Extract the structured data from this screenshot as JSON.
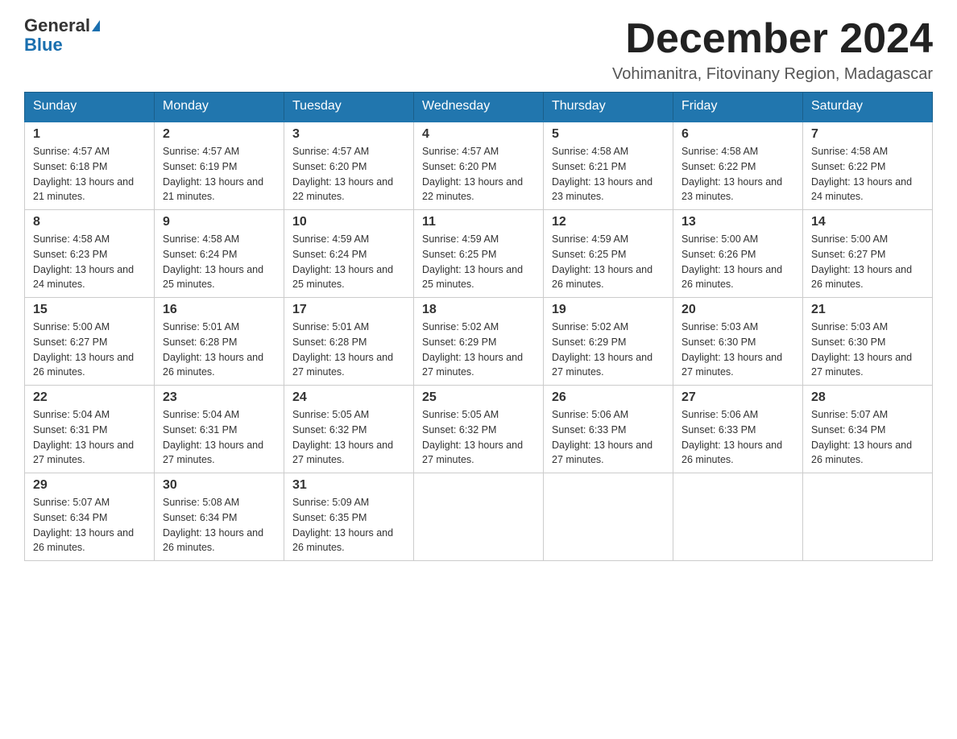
{
  "header": {
    "logo_general": "General",
    "logo_blue": "Blue",
    "month_title": "December 2024",
    "location": "Vohimanitra, Fitovinany Region, Madagascar"
  },
  "weekdays": [
    "Sunday",
    "Monday",
    "Tuesday",
    "Wednesday",
    "Thursday",
    "Friday",
    "Saturday"
  ],
  "weeks": [
    [
      {
        "day": "1",
        "sunrise": "4:57 AM",
        "sunset": "6:18 PM",
        "daylight": "13 hours and 21 minutes."
      },
      {
        "day": "2",
        "sunrise": "4:57 AM",
        "sunset": "6:19 PM",
        "daylight": "13 hours and 21 minutes."
      },
      {
        "day": "3",
        "sunrise": "4:57 AM",
        "sunset": "6:20 PM",
        "daylight": "13 hours and 22 minutes."
      },
      {
        "day": "4",
        "sunrise": "4:57 AM",
        "sunset": "6:20 PM",
        "daylight": "13 hours and 22 minutes."
      },
      {
        "day": "5",
        "sunrise": "4:58 AM",
        "sunset": "6:21 PM",
        "daylight": "13 hours and 23 minutes."
      },
      {
        "day": "6",
        "sunrise": "4:58 AM",
        "sunset": "6:22 PM",
        "daylight": "13 hours and 23 minutes."
      },
      {
        "day": "7",
        "sunrise": "4:58 AM",
        "sunset": "6:22 PM",
        "daylight": "13 hours and 24 minutes."
      }
    ],
    [
      {
        "day": "8",
        "sunrise": "4:58 AM",
        "sunset": "6:23 PM",
        "daylight": "13 hours and 24 minutes."
      },
      {
        "day": "9",
        "sunrise": "4:58 AM",
        "sunset": "6:24 PM",
        "daylight": "13 hours and 25 minutes."
      },
      {
        "day": "10",
        "sunrise": "4:59 AM",
        "sunset": "6:24 PM",
        "daylight": "13 hours and 25 minutes."
      },
      {
        "day": "11",
        "sunrise": "4:59 AM",
        "sunset": "6:25 PM",
        "daylight": "13 hours and 25 minutes."
      },
      {
        "day": "12",
        "sunrise": "4:59 AM",
        "sunset": "6:25 PM",
        "daylight": "13 hours and 26 minutes."
      },
      {
        "day": "13",
        "sunrise": "5:00 AM",
        "sunset": "6:26 PM",
        "daylight": "13 hours and 26 minutes."
      },
      {
        "day": "14",
        "sunrise": "5:00 AM",
        "sunset": "6:27 PM",
        "daylight": "13 hours and 26 minutes."
      }
    ],
    [
      {
        "day": "15",
        "sunrise": "5:00 AM",
        "sunset": "6:27 PM",
        "daylight": "13 hours and 26 minutes."
      },
      {
        "day": "16",
        "sunrise": "5:01 AM",
        "sunset": "6:28 PM",
        "daylight": "13 hours and 26 minutes."
      },
      {
        "day": "17",
        "sunrise": "5:01 AM",
        "sunset": "6:28 PM",
        "daylight": "13 hours and 27 minutes."
      },
      {
        "day": "18",
        "sunrise": "5:02 AM",
        "sunset": "6:29 PM",
        "daylight": "13 hours and 27 minutes."
      },
      {
        "day": "19",
        "sunrise": "5:02 AM",
        "sunset": "6:29 PM",
        "daylight": "13 hours and 27 minutes."
      },
      {
        "day": "20",
        "sunrise": "5:03 AM",
        "sunset": "6:30 PM",
        "daylight": "13 hours and 27 minutes."
      },
      {
        "day": "21",
        "sunrise": "5:03 AM",
        "sunset": "6:30 PM",
        "daylight": "13 hours and 27 minutes."
      }
    ],
    [
      {
        "day": "22",
        "sunrise": "5:04 AM",
        "sunset": "6:31 PM",
        "daylight": "13 hours and 27 minutes."
      },
      {
        "day": "23",
        "sunrise": "5:04 AM",
        "sunset": "6:31 PM",
        "daylight": "13 hours and 27 minutes."
      },
      {
        "day": "24",
        "sunrise": "5:05 AM",
        "sunset": "6:32 PM",
        "daylight": "13 hours and 27 minutes."
      },
      {
        "day": "25",
        "sunrise": "5:05 AM",
        "sunset": "6:32 PM",
        "daylight": "13 hours and 27 minutes."
      },
      {
        "day": "26",
        "sunrise": "5:06 AM",
        "sunset": "6:33 PM",
        "daylight": "13 hours and 27 minutes."
      },
      {
        "day": "27",
        "sunrise": "5:06 AM",
        "sunset": "6:33 PM",
        "daylight": "13 hours and 26 minutes."
      },
      {
        "day": "28",
        "sunrise": "5:07 AM",
        "sunset": "6:34 PM",
        "daylight": "13 hours and 26 minutes."
      }
    ],
    [
      {
        "day": "29",
        "sunrise": "5:07 AM",
        "sunset": "6:34 PM",
        "daylight": "13 hours and 26 minutes."
      },
      {
        "day": "30",
        "sunrise": "5:08 AM",
        "sunset": "6:34 PM",
        "daylight": "13 hours and 26 minutes."
      },
      {
        "day": "31",
        "sunrise": "5:09 AM",
        "sunset": "6:35 PM",
        "daylight": "13 hours and 26 minutes."
      },
      null,
      null,
      null,
      null
    ]
  ]
}
